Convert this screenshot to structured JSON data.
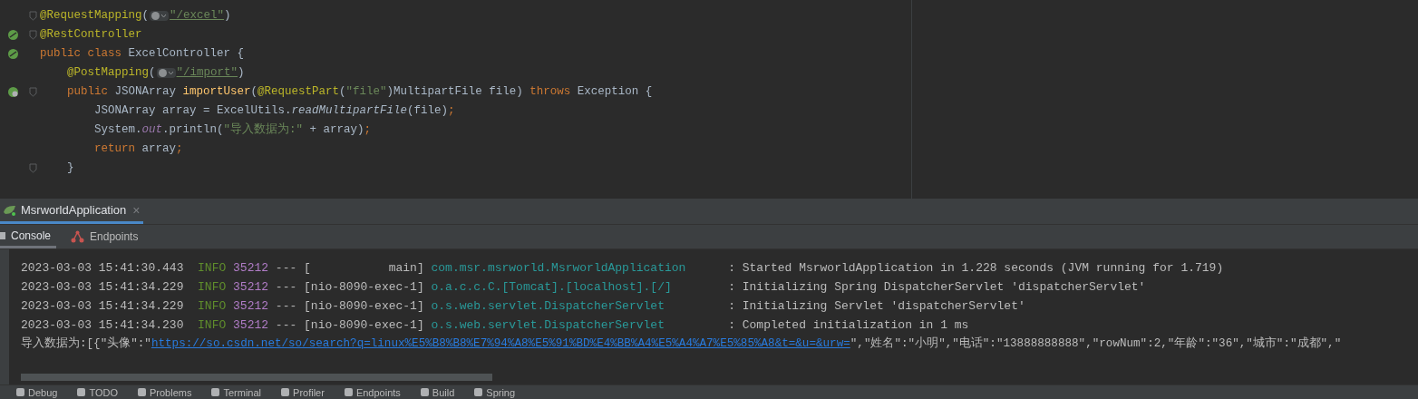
{
  "editor": {
    "lines": [
      {
        "fold": true,
        "tokens": [
          {
            "kind": "annotation",
            "text": "@RequestMapping"
          },
          {
            "kind": "plain",
            "text": "("
          },
          {
            "kind": "web-icon"
          },
          {
            "kind": "link-string",
            "text": "\"/excel\""
          },
          {
            "kind": "plain",
            "text": ")"
          }
        ]
      },
      {
        "fold": true,
        "kind": "bean",
        "tokens": [
          {
            "kind": "annotation",
            "text": "@RestController"
          }
        ]
      },
      {
        "fold": false,
        "kind": "bean",
        "tokens": [
          {
            "kind": "keyword",
            "text": "public class "
          },
          {
            "kind": "plain",
            "text": "ExcelController {"
          }
        ]
      },
      {
        "fold": false,
        "tokens": [
          {
            "kind": "annotation",
            "text": "    @PostMapping"
          },
          {
            "kind": "plain",
            "text": "("
          },
          {
            "kind": "web-icon"
          },
          {
            "kind": "link-string",
            "text": "\"/import\""
          },
          {
            "kind": "plain",
            "text": ")"
          }
        ]
      },
      {
        "fold": true,
        "kind": "web",
        "tokens": [
          {
            "kind": "keyword",
            "text": "    public "
          },
          {
            "kind": "plain",
            "text": "JSONArray "
          },
          {
            "kind": "method",
            "text": "importUser"
          },
          {
            "kind": "plain",
            "text": "("
          },
          {
            "kind": "annotation",
            "text": "@RequestPart"
          },
          {
            "kind": "plain",
            "text": "("
          },
          {
            "kind": "string",
            "text": "\"file\""
          },
          {
            "kind": "plain",
            "text": ")MultipartFile file) "
          },
          {
            "kind": "keyword",
            "text": "throws "
          },
          {
            "kind": "plain",
            "text": "Exception {"
          }
        ]
      },
      {
        "fold": false,
        "tokens": [
          {
            "kind": "plain",
            "text": "        JSONArray array = ExcelUtils."
          },
          {
            "kind": "static-method",
            "text": "readMultipartFile"
          },
          {
            "kind": "plain",
            "text": "(file)"
          },
          {
            "kind": "keyword",
            "text": ";"
          }
        ]
      },
      {
        "fold": false,
        "tokens": [
          {
            "kind": "plain",
            "text": "        System."
          },
          {
            "kind": "static-field",
            "text": "out"
          },
          {
            "kind": "plain",
            "text": ".println("
          },
          {
            "kind": "string",
            "text": "\"导入数据为:\""
          },
          {
            "kind": "plain",
            "text": " + array)"
          },
          {
            "kind": "keyword",
            "text": ";"
          }
        ]
      },
      {
        "fold": false,
        "tokens": [
          {
            "kind": "keyword",
            "text": "        return "
          },
          {
            "kind": "plain",
            "text": "array"
          },
          {
            "kind": "keyword",
            "text": ";"
          }
        ]
      },
      {
        "fold": true,
        "tokens": [
          {
            "kind": "plain",
            "text": "    }"
          }
        ]
      }
    ]
  },
  "run_tabs": [
    {
      "label": "MsrworldApplication",
      "selected": true,
      "close": "×"
    }
  ],
  "console_tabs": [
    {
      "label": "Console",
      "selected": true
    },
    {
      "label": "Endpoints",
      "selected": false
    }
  ],
  "log": [
    {
      "kind": "log",
      "timestamp": "2023-03-03 15:41:30.443",
      "level": "INFO",
      "pid": "35212",
      "sep": "---",
      "thread": "[           main]",
      "logger": "com.msr.msrworld.MsrworldApplication",
      "message": ": Started MsrworldApplication in 1.228 seconds (JVM running for 1.719)"
    },
    {
      "kind": "log",
      "timestamp": "2023-03-03 15:41:34.229",
      "level": "INFO",
      "pid": "35212",
      "sep": "---",
      "thread": "[nio-8090-exec-1]",
      "logger": "o.a.c.c.C.[Tomcat].[localhost].[/]",
      "message": ": Initializing Spring DispatcherServlet 'dispatcherServlet'"
    },
    {
      "kind": "log",
      "timestamp": "2023-03-03 15:41:34.229",
      "level": "INFO",
      "pid": "35212",
      "sep": "---",
      "thread": "[nio-8090-exec-1]",
      "logger": "o.s.web.servlet.DispatcherServlet",
      "message": ": Initializing Servlet 'dispatcherServlet'"
    },
    {
      "kind": "log",
      "timestamp": "2023-03-03 15:41:34.230",
      "level": "INFO",
      "pid": "35212",
      "sep": "---",
      "thread": "[nio-8090-exec-1]",
      "logger": "o.s.web.servlet.DispatcherServlet",
      "message": ": Completed initialization in 1 ms"
    },
    {
      "kind": "output",
      "prefix": "导入数据为:[{\"头像\":\"",
      "link": "https://so.csdn.net/so/search?q=linux%E5%B8%B8%E7%94%A8%E5%91%BD%E4%BB%A4%E5%A4%A7%E5%85%A8&t=&u=&urw=",
      "suffix": "\",\"姓名\":\"小明\",\"电话\":\"13888888888\",\"rowNum\":2,\"年龄\":\"36\",\"城市\":\"成都\",\""
    }
  ],
  "tool_windows": [
    "Debug",
    "TODO",
    "Problems",
    "Terminal",
    "Profiler",
    "Endpoints",
    "Build",
    "Spring"
  ]
}
